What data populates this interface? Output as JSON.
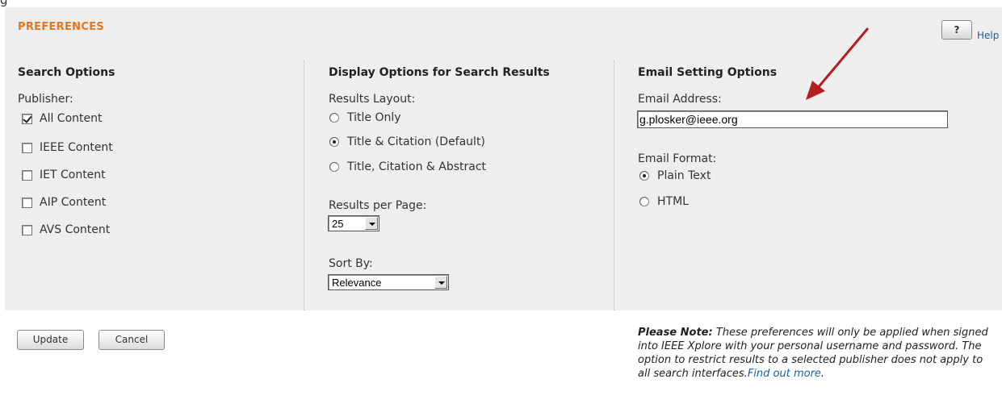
{
  "top_strip_text": "g",
  "panel": {
    "title": "PREFERENCES",
    "help_box": "?",
    "help_link": "Help"
  },
  "search_options": {
    "heading": "Search Options",
    "publisher_label": "Publisher:",
    "publishers": [
      {
        "label": "All Content",
        "checked": true
      },
      {
        "label": "IEEE Content",
        "checked": false
      },
      {
        "label": "IET Content",
        "checked": false
      },
      {
        "label": "AIP Content",
        "checked": false
      },
      {
        "label": "AVS Content",
        "checked": false
      }
    ]
  },
  "display_options": {
    "heading": "Display Options for Search Results",
    "layout_label": "Results Layout:",
    "layouts": [
      {
        "label": "Title Only",
        "selected": false
      },
      {
        "label": "Title & Citation (Default)",
        "selected": true
      },
      {
        "label": "Title, Citation & Abstract",
        "selected": false
      }
    ],
    "per_page_label": "Results per Page:",
    "per_page_value": "25",
    "sort_label": "Sort By:",
    "sort_value": "Relevance"
  },
  "email_options": {
    "heading": "Email Setting Options",
    "address_label": "Email Address:",
    "address_value": "g.plosker@ieee.org",
    "format_label": "Email Format:",
    "formats": [
      {
        "label": "Plain Text",
        "selected": true
      },
      {
        "label": "HTML",
        "selected": false
      }
    ]
  },
  "buttons": {
    "update": "Update",
    "cancel": "Cancel"
  },
  "note": {
    "strong": "Please Note:",
    "text": " These preferences will only be applied when signed into IEEE Xplore with your personal username and password. The option to restrict results to a selected publisher does not apply to all search interfaces.",
    "link": "Find out more",
    "end": "."
  },
  "colors": {
    "accent": "#e8741c",
    "link": "#1a5fa8",
    "panel_bg": "#eeeeee",
    "annotation_arrow": "#b51e1e"
  },
  "icons": [
    "help-icon",
    "checkbox-icon",
    "radio-icon",
    "dropdown-arrow-icon",
    "annotation-arrow-icon"
  ]
}
